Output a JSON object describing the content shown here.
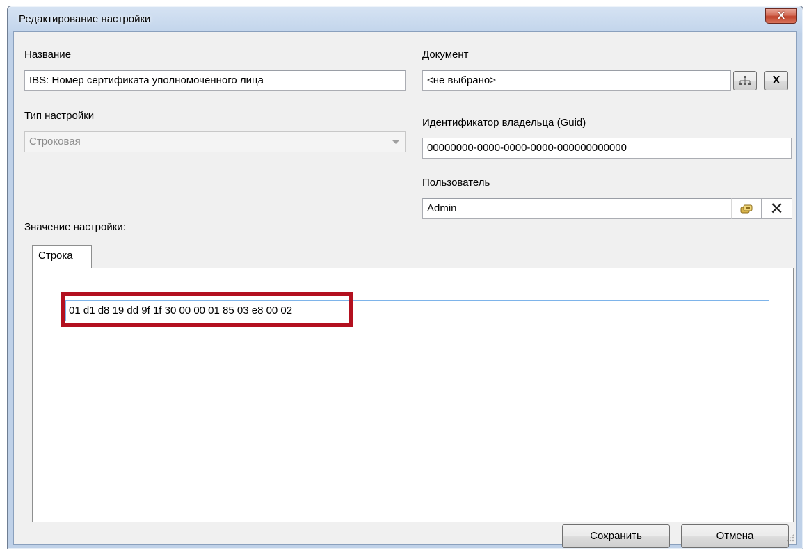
{
  "window": {
    "title": "Редактирование настройки",
    "close_label": "X"
  },
  "form": {
    "name_label": "Название",
    "name_value": "IBS: Номер сертификата уполномоченного лица",
    "type_label": "Тип настройки",
    "type_value": "Строковая",
    "document_label": "Документ",
    "document_value": "<не выбрано>",
    "owner_guid_label": "Идентификатор владельца (Guid)",
    "owner_guid_value": "00000000-0000-0000-0000-000000000000",
    "user_label": "Пользователь",
    "user_value": "Admin",
    "setting_value_label": "Значение настройки:"
  },
  "tabs": [
    {
      "label": "Строка"
    }
  ],
  "value": {
    "text": "01 d1 d8 19 dd 9f 1f 30 00 00 01 85 03 e8 00 02"
  },
  "buttons": {
    "save": "Сохранить",
    "cancel": "Отмена",
    "clear": "X",
    "clear_user": "✕"
  },
  "colors": {
    "highlight": "#b3101f",
    "titlebar": "#c4d6ec",
    "close": "#c0432c"
  },
  "icons": {
    "document_picker": "hierarchy-icon",
    "user_picker": "users-icon"
  }
}
